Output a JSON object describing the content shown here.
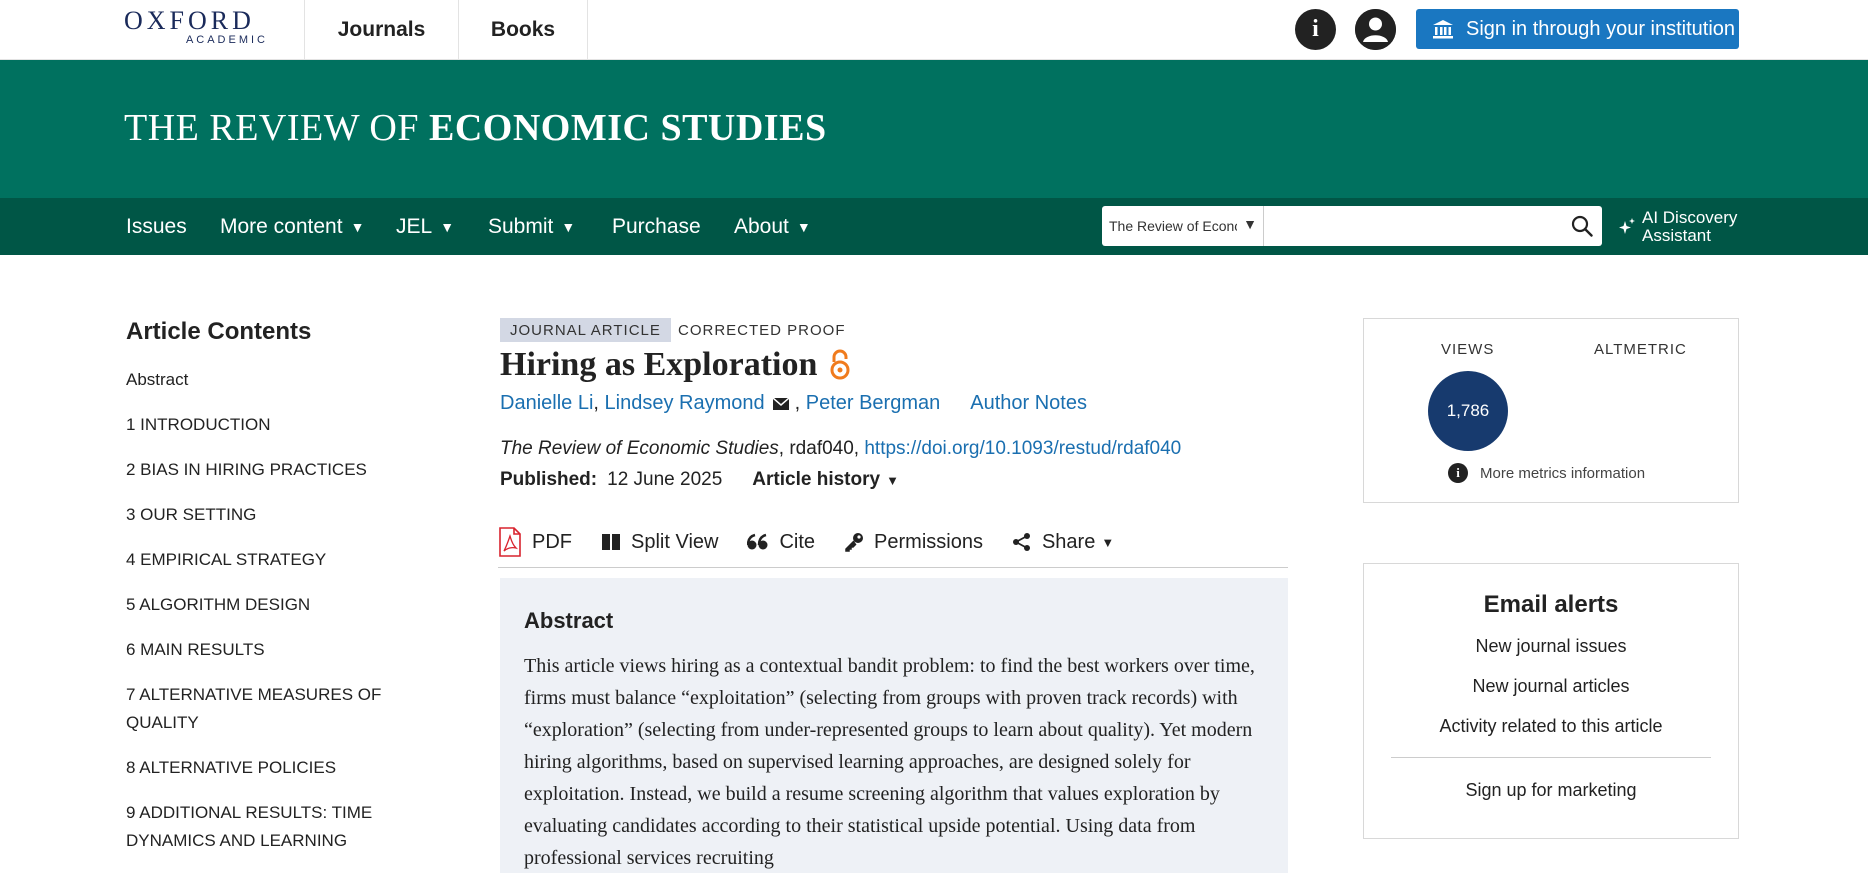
{
  "header": {
    "logo_line1": "OXFORD",
    "logo_line2": "ACADEMIC",
    "nav": [
      "Journals",
      "Books"
    ],
    "signin_label": "Sign in through your institution",
    "info_icon": "info-icon",
    "user_icon": "user-icon",
    "accent_color": "#1a77c1"
  },
  "banner": {
    "title_regular": "THE REVIEW OF ",
    "title_bold": "ECONOMIC STUDIES",
    "color": "#00715f"
  },
  "nav": {
    "items": [
      {
        "label": "Issues",
        "caret": ""
      },
      {
        "label": "More content",
        "caret": "▼"
      },
      {
        "label": "JEL",
        "caret": "▼"
      },
      {
        "label": "Submit",
        "caret": "▼"
      },
      {
        "label": "Purchase",
        "caret": ""
      },
      {
        "label": "About",
        "caret": "▼"
      }
    ],
    "search_scope": "The Review of Economic Studies",
    "search_placeholder": "",
    "ai_line1": "AI Discovery",
    "ai_line2": "Assistant",
    "color": "#005646"
  },
  "sidebar": {
    "title": "Article Contents",
    "items": [
      "Abstract",
      "1 INTRODUCTION",
      "2 BIAS IN HIRING PRACTICES",
      "3 OUR SETTING",
      "4 EMPIRICAL STRATEGY",
      "5 ALGORITHM DESIGN",
      "6 MAIN RESULTS",
      "7 ALTERNATIVE MEASURES OF QUALITY",
      "8 ALTERNATIVE POLICIES",
      "9 ADDITIONAL RESULTS: TIME DYNAMICS AND LEARNING"
    ]
  },
  "article": {
    "type_badge": "JOURNAL ARTICLE",
    "status_badge": "CORRECTED PROOF",
    "title": "Hiring as Exploration",
    "authors": [
      "Danielle Li",
      "Lindsey Raymond",
      "Peter Bergman"
    ],
    "author_notes": "Author Notes",
    "journal": "The Review of Economic Studies",
    "article_id": ", rdaf040, ",
    "doi": "https://doi.org/10.1093/restud/rdaf040",
    "published_label": "Published:",
    "published_date": "12 June 2025",
    "history_label": "Article history",
    "tools": {
      "pdf": "PDF",
      "split": "Split View",
      "cite": "Cite",
      "permissions": "Permissions",
      "share": "Share"
    },
    "abstract_title": "Abstract",
    "abstract_text": "This article views hiring as a contextual bandit problem: to find the best workers over time, firms must balance “exploitation” (selecting from groups with proven track records) with “exploration” (selecting from under-represented groups to learn about quality). Yet modern hiring algorithms, based on supervised learning approaches, are designed solely for exploitation. Instead, we build a resume screening algorithm that values exploration by evaluating candidates according to their statistical upside potential. Using data from professional services recruiting"
  },
  "metrics": {
    "views_label": "VIEWS",
    "altmetric_label": "ALTMETRIC",
    "views_count": "1,786",
    "more_info": "More metrics information"
  },
  "alerts": {
    "title": "Email alerts",
    "links": [
      "New journal issues",
      "New journal articles",
      "Activity related to this article"
    ],
    "marketing": "Sign up for marketing"
  }
}
